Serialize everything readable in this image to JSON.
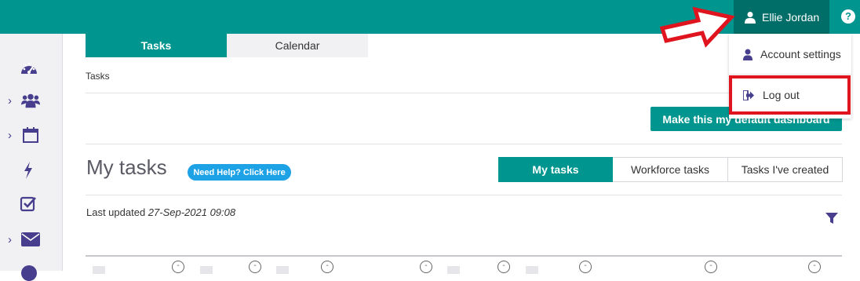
{
  "header": {
    "user_name": "Ellie Jordan",
    "help_label": "?"
  },
  "user_menu": {
    "items": [
      {
        "label": "Account settings",
        "icon": "user-icon"
      },
      {
        "label": "Log out",
        "icon": "sign-out-icon"
      }
    ]
  },
  "top_tabs": [
    {
      "label": "Tasks",
      "active": true
    },
    {
      "label": "Calendar",
      "active": false
    }
  ],
  "breadcrumb": "Tasks",
  "default_dashboard_button": "Make this my default dashboard",
  "page_title": "My tasks",
  "help_pill": "Need Help? Click Here",
  "task_filters": [
    {
      "label": "My tasks",
      "active": true
    },
    {
      "label": "Workforce tasks",
      "active": false
    },
    {
      "label": "Tasks I've created",
      "active": false
    }
  ],
  "last_updated": {
    "label": "Last updated ",
    "value": "27-Sep-2021 09:08"
  },
  "sidebar": [
    {
      "icon": "dashboard-icon",
      "expandable": false
    },
    {
      "icon": "users-icon",
      "expandable": true
    },
    {
      "icon": "calendar-icon",
      "expandable": true
    },
    {
      "icon": "bolt-icon",
      "expandable": false
    },
    {
      "icon": "checkbox-icon",
      "expandable": false
    },
    {
      "icon": "envelope-icon",
      "expandable": true
    }
  ],
  "colors": {
    "teal": "#00968f",
    "dark_teal": "#006e68",
    "sidebar_icon": "#473f8e",
    "highlight_red": "#e0141e",
    "pill_blue": "#1ea2e6"
  }
}
